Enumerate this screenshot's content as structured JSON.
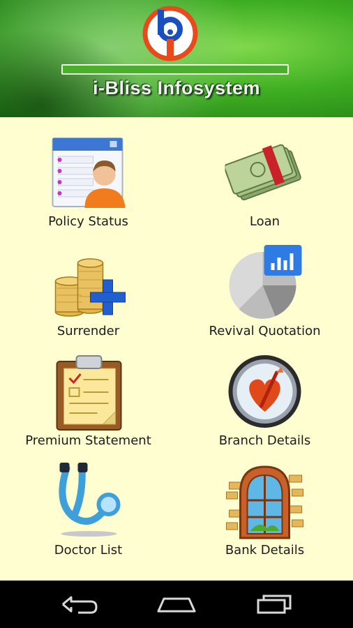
{
  "header": {
    "brand_name": "i-Bliss Infosystem",
    "progress_percent": 100,
    "logo_letters": "bi"
  },
  "menu": {
    "items": [
      {
        "label": "Policy Status",
        "icon": "policy-user-icon"
      },
      {
        "label": "Loan",
        "icon": "money-bundle-icon"
      },
      {
        "label": "Surrender",
        "icon": "coins-plus-icon"
      },
      {
        "label": "Revival Quotation",
        "icon": "pie-chart-icon"
      },
      {
        "label": "Premium Statement",
        "icon": "clipboard-icon"
      },
      {
        "label": "Branch Details",
        "icon": "heart-clock-icon"
      },
      {
        "label": "Doctor List",
        "icon": "stethoscope-icon"
      },
      {
        "label": "Bank Details",
        "icon": "arched-window-icon"
      }
    ]
  },
  "colors": {
    "background": "#fefed0",
    "header_green": "#3fae22",
    "logo_red": "#e84a1c",
    "logo_blue": "#1a4fbf"
  },
  "navbar": {
    "buttons": [
      "back",
      "home",
      "recent-apps"
    ]
  }
}
